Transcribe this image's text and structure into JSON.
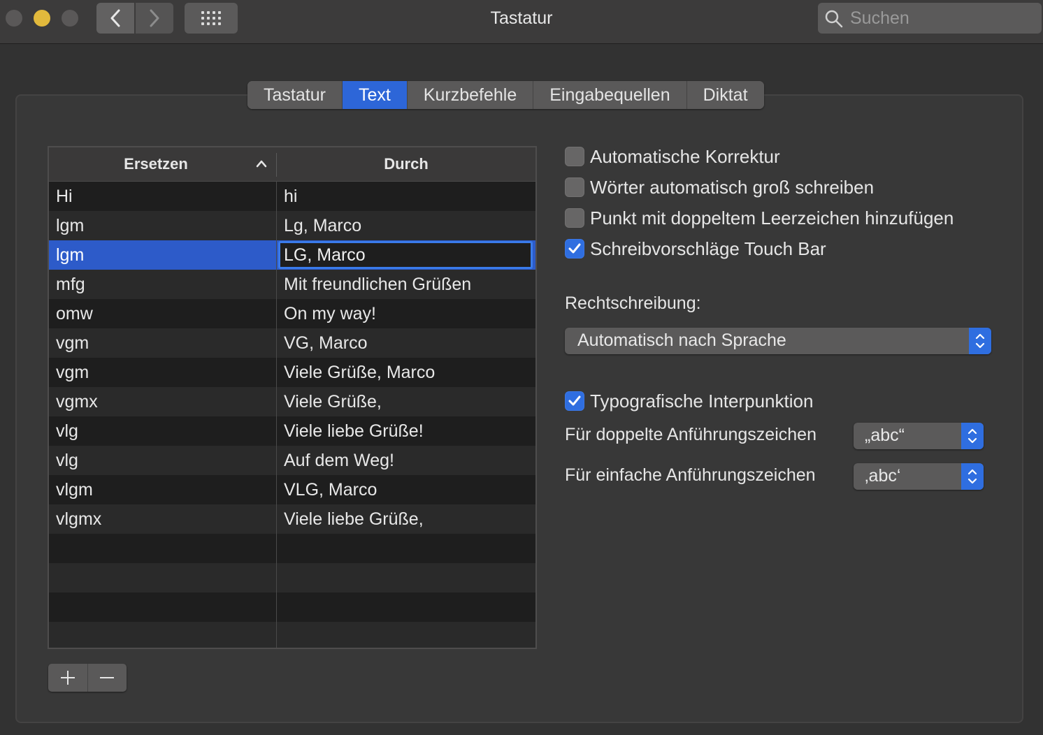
{
  "window": {
    "title": "Tastatur",
    "search_placeholder": "Suchen"
  },
  "tabs": [
    {
      "label": "Tastatur",
      "active": false
    },
    {
      "label": "Text",
      "active": true
    },
    {
      "label": "Kurzbefehle",
      "active": false
    },
    {
      "label": "Eingabequellen",
      "active": false
    },
    {
      "label": "Diktat",
      "active": false
    }
  ],
  "table": {
    "headers": {
      "replace": "Ersetzen",
      "with": "Durch"
    },
    "sort_column": "Ersetzen",
    "sort_direction": "ascending",
    "rows": [
      {
        "replace": "Hi",
        "with": "hi"
      },
      {
        "replace": "lgm",
        "with": "Lg, Marco"
      },
      {
        "replace": "lgm",
        "with": "LG, Marco",
        "selected": true
      },
      {
        "replace": "mfg",
        "with": "Mit freundlichen Grüßen"
      },
      {
        "replace": "omw",
        "with": "On my way!"
      },
      {
        "replace": "vgm",
        "with": "VG, Marco"
      },
      {
        "replace": "vgm",
        "with": "Viele Grüße, Marco"
      },
      {
        "replace": "vgmx",
        "with": "Viele Grüße,"
      },
      {
        "replace": "vlg",
        "with": "Viele liebe Grüße!"
      },
      {
        "replace": "vlg",
        "with": "Auf dem Weg!"
      },
      {
        "replace": "vlgm",
        "with": "VLG, Marco"
      },
      {
        "replace": "vlgmx",
        "with": "Viele liebe Grüße,"
      }
    ]
  },
  "options": {
    "auto_correct": {
      "label": "Automatische Korrektur",
      "checked": false
    },
    "auto_capitalize": {
      "label": "Wörter automatisch groß schreiben",
      "checked": false
    },
    "double_space_period": {
      "label": "Punkt mit doppeltem Leerzeichen hinzufügen",
      "checked": false
    },
    "touch_bar_suggestions": {
      "label": "Schreibvorschläge Touch Bar",
      "checked": true
    },
    "spelling_label": "Rechtschreibung:",
    "spelling_value": "Automatisch nach Sprache",
    "smart_quotes": {
      "label": "Typografische Interpunktion",
      "checked": true
    },
    "double_quotes_label": "Für doppelte Anführungszeichen",
    "double_quotes_value": "„abc“",
    "single_quotes_label": "Für einfache Anführungszeichen",
    "single_quotes_value": "‚abc‘"
  },
  "colors": {
    "accent": "#2f6ee0",
    "selection": "#2d5bc9",
    "minimize": "#e2b93c"
  }
}
